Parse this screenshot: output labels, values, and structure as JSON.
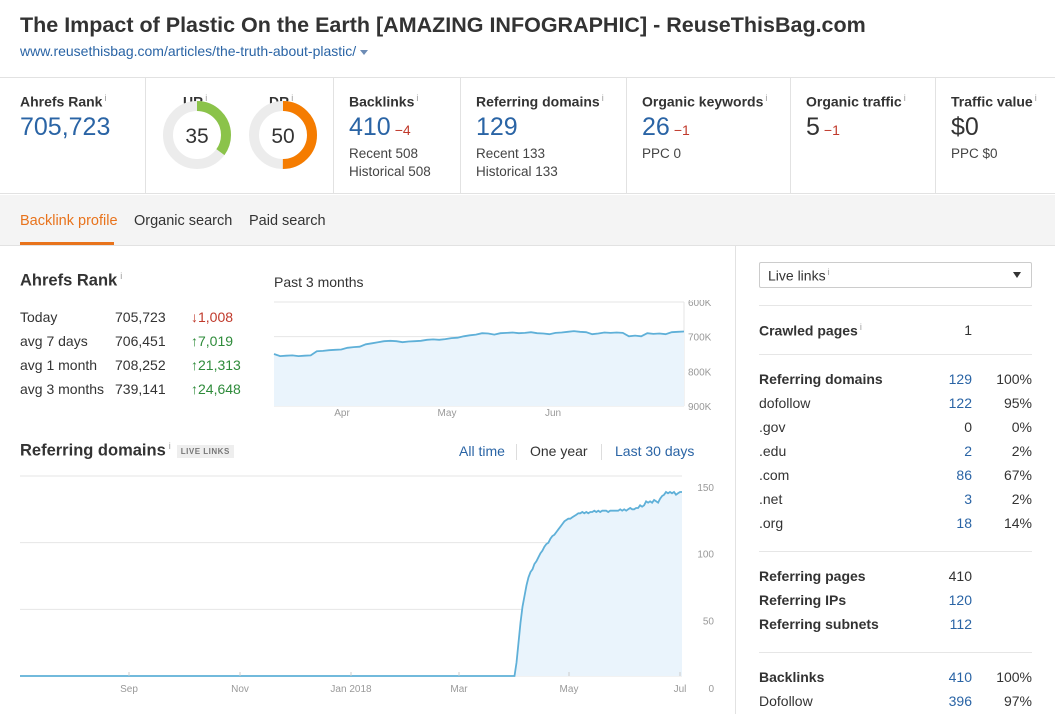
{
  "page": {
    "title": "The Impact of Plastic On the Earth [AMAZING INFOGRAPHIC] - ReuseThisBag.com",
    "url": "www.reusethisbag.com/articles/the-truth-about-plastic/"
  },
  "metrics": {
    "ahrefs_rank": {
      "label": "Ahrefs Rank",
      "info": "i",
      "value": "705,723"
    },
    "ur": {
      "label": "UR",
      "info": "i",
      "value": "35",
      "level": 35,
      "color": "#8bc34a"
    },
    "dr": {
      "label": "DR",
      "info": "i",
      "value": "50",
      "level": 50,
      "color": "#f57c00"
    },
    "backlinks": {
      "label": "Backlinks",
      "info": "i",
      "value": "410",
      "delta": "−4",
      "recent": "Recent 508",
      "historical": "Historical 508"
    },
    "referring_domains": {
      "label": "Referring domains",
      "info": "i",
      "value": "129",
      "recent": "Recent 133",
      "historical": "Historical 133"
    },
    "organic_keywords": {
      "label": "Organic keywords",
      "info": "i",
      "value": "26",
      "delta": "−1",
      "ppc": "PPC 0"
    },
    "organic_traffic": {
      "label": "Organic traffic",
      "info": "i",
      "value": "5",
      "delta": "−1"
    },
    "traffic_value": {
      "label": "Traffic value",
      "info": "i",
      "value": "$0",
      "ppc": "PPC $0"
    }
  },
  "tabs": [
    {
      "label": "Backlink profile",
      "active": true
    },
    {
      "label": "Organic search",
      "active": false
    },
    {
      "label": "Paid search",
      "active": false
    }
  ],
  "ahrefs_rank_section": {
    "title": "Ahrefs Rank",
    "info": "i",
    "rows": [
      {
        "label": "Today",
        "value": "705,723",
        "change": "↓1,008",
        "dir": "down"
      },
      {
        "label": "avg 7 days",
        "value": "706,451",
        "change": "↑7,019",
        "dir": "up"
      },
      {
        "label": "avg 1 month",
        "value": "708,252",
        "change": "↑21,313",
        "dir": "up"
      },
      {
        "label": "avg 3 months",
        "value": "739,141",
        "change": "↑24,648",
        "dir": "up"
      }
    ],
    "chart_caption": "Past 3 months"
  },
  "referring_domains_section": {
    "title": "Referring domains",
    "info": "i",
    "badge": "LIVE LINKS",
    "ranges": [
      {
        "label": "All time",
        "selected": false
      },
      {
        "label": "One year",
        "selected": true
      },
      {
        "label": "Last 30 days",
        "selected": false
      }
    ]
  },
  "right_panel": {
    "select_label": "Live links",
    "select_info": "i",
    "crawled": {
      "label": "Crawled pages",
      "info": "i",
      "value": "1"
    },
    "domains": [
      {
        "label": "Referring domains",
        "value": "129",
        "pct": "100%",
        "bold": true
      },
      {
        "label": "dofollow",
        "value": "122",
        "pct": "95%"
      },
      {
        "label": ".gov",
        "value": "0",
        "pct": "0%",
        "plain": true
      },
      {
        "label": ".edu",
        "value": "2",
        "pct": "2%"
      },
      {
        "label": ".com",
        "value": "86",
        "pct": "67%"
      },
      {
        "label": ".net",
        "value": "3",
        "pct": "2%"
      },
      {
        "label": ".org",
        "value": "18",
        "pct": "14%"
      }
    ],
    "pages": [
      {
        "label": "Referring pages",
        "value": "410",
        "plain": true
      },
      {
        "label": "Referring IPs",
        "value": "120"
      },
      {
        "label": "Referring subnets",
        "value": "112"
      }
    ],
    "backlinks": [
      {
        "label": "Backlinks",
        "value": "410",
        "pct": "100%",
        "bold": true
      },
      {
        "label": "Dofollow",
        "value": "396",
        "pct": "97%"
      }
    ]
  },
  "chart_data": [
    {
      "type": "area",
      "title": "Past 3 months",
      "x_ticks": [
        "Apr",
        "May",
        "Jun"
      ],
      "y_ticks": [
        "600K",
        "700K",
        "800K",
        "900K"
      ],
      "y_inverted": true,
      "ylim": [
        600000,
        900000
      ],
      "series": [
        {
          "values": [
            750000,
            756000,
            755000,
            754000,
            756000,
            755000,
            754000,
            742000,
            741000,
            739000,
            738000,
            737000,
            732000,
            730000,
            729000,
            722000,
            719000,
            716000,
            713000,
            712000,
            713000,
            716000,
            714000,
            713000,
            712000,
            709000,
            708000,
            709000,
            707000,
            704000,
            703000,
            699000,
            696000,
            694000,
            690000,
            691000,
            694000,
            690000,
            689000,
            688000,
            690000,
            689000,
            687000,
            690000,
            691000,
            693000,
            689000,
            688000,
            686000,
            684000,
            686000,
            687000,
            693000,
            691000,
            688000,
            689000,
            688000,
            689000,
            699000,
            697000,
            699000,
            690000,
            692000,
            691000,
            693000,
            687000,
            686000,
            685000
          ]
        }
      ]
    },
    {
      "type": "area",
      "title": "Referring domains",
      "x_ticks": [
        "Sep",
        "Nov",
        "Jan 2018",
        "Mar",
        "May",
        "Jul"
      ],
      "y_ticks": [
        "150",
        "100",
        "50",
        "0"
      ],
      "ylim": [
        0,
        150
      ],
      "series": [
        {
          "values": [
            0,
            0,
            0,
            0,
            0,
            0,
            0,
            0,
            0,
            0,
            0,
            0,
            0,
            0,
            0,
            0,
            0,
            0,
            0,
            0,
            0,
            0,
            0,
            0,
            0,
            0,
            0,
            0,
            0,
            0,
            0,
            0,
            0,
            0,
            0,
            0,
            0,
            0,
            0,
            0,
            0,
            0,
            0,
            0,
            0,
            0,
            0,
            0,
            0,
            0,
            0,
            0,
            0,
            0,
            0,
            0,
            0,
            0,
            0,
            0,
            0,
            0,
            0,
            0,
            0,
            0,
            0,
            0,
            0,
            0,
            0,
            0,
            0,
            0,
            0,
            0,
            0,
            0,
            0,
            0,
            0,
            0,
            0,
            0,
            0,
            0,
            0,
            0,
            0,
            0,
            0,
            0,
            0,
            0,
            0,
            0,
            0,
            0,
            0,
            0,
            0,
            0,
            0,
            0,
            0,
            0,
            0,
            0,
            0,
            0,
            0,
            0,
            0,
            0,
            0,
            0,
            0,
            0,
            0,
            0,
            0,
            0,
            0,
            0,
            0,
            0,
            0,
            0,
            0,
            0,
            0,
            0,
            0,
            0,
            0,
            0,
            0,
            0,
            0,
            0,
            0,
            0,
            0,
            0,
            0,
            0,
            0,
            0,
            0,
            0,
            0,
            0,
            0,
            0,
            0,
            0,
            0,
            0,
            0,
            0,
            0,
            0,
            0,
            0,
            0,
            0,
            0,
            0,
            0,
            0,
            0,
            0,
            0,
            0,
            0,
            0,
            0,
            0,
            0,
            0,
            0,
            0,
            0,
            0,
            0,
            0,
            0,
            0,
            0,
            0,
            0,
            0,
            0,
            0,
            0,
            0,
            0,
            0,
            0,
            0,
            0,
            0,
            0,
            0,
            0,
            0,
            0,
            0,
            0,
            0,
            0,
            0,
            0,
            0,
            0,
            0,
            0,
            0,
            0,
            0,
            0,
            0,
            0,
            0,
            0,
            0,
            0,
            0,
            0,
            0,
            0,
            0,
            0,
            0,
            0,
            0,
            0,
            0,
            0,
            0,
            0,
            0,
            0,
            0,
            0,
            0,
            0,
            0,
            0,
            10,
            25,
            40,
            52,
            60,
            68,
            74,
            78,
            80,
            84,
            86,
            89,
            92,
            94,
            97,
            99,
            100,
            103,
            105,
            106,
            108,
            110,
            112,
            114,
            116,
            117,
            118,
            118,
            119,
            120,
            121,
            122,
            122,
            123,
            122,
            123,
            122,
            123,
            123,
            124,
            123,
            124,
            123,
            124,
            124,
            124,
            123,
            124,
            124,
            124,
            124,
            124,
            125,
            124,
            125,
            124,
            125,
            126,
            125,
            125,
            126,
            126,
            128,
            127,
            128,
            131,
            130,
            131,
            130,
            132,
            131,
            130,
            133,
            135,
            136,
            138,
            137,
            138,
            137,
            138,
            136,
            137,
            138,
            138
          ]
        }
      ]
    }
  ]
}
